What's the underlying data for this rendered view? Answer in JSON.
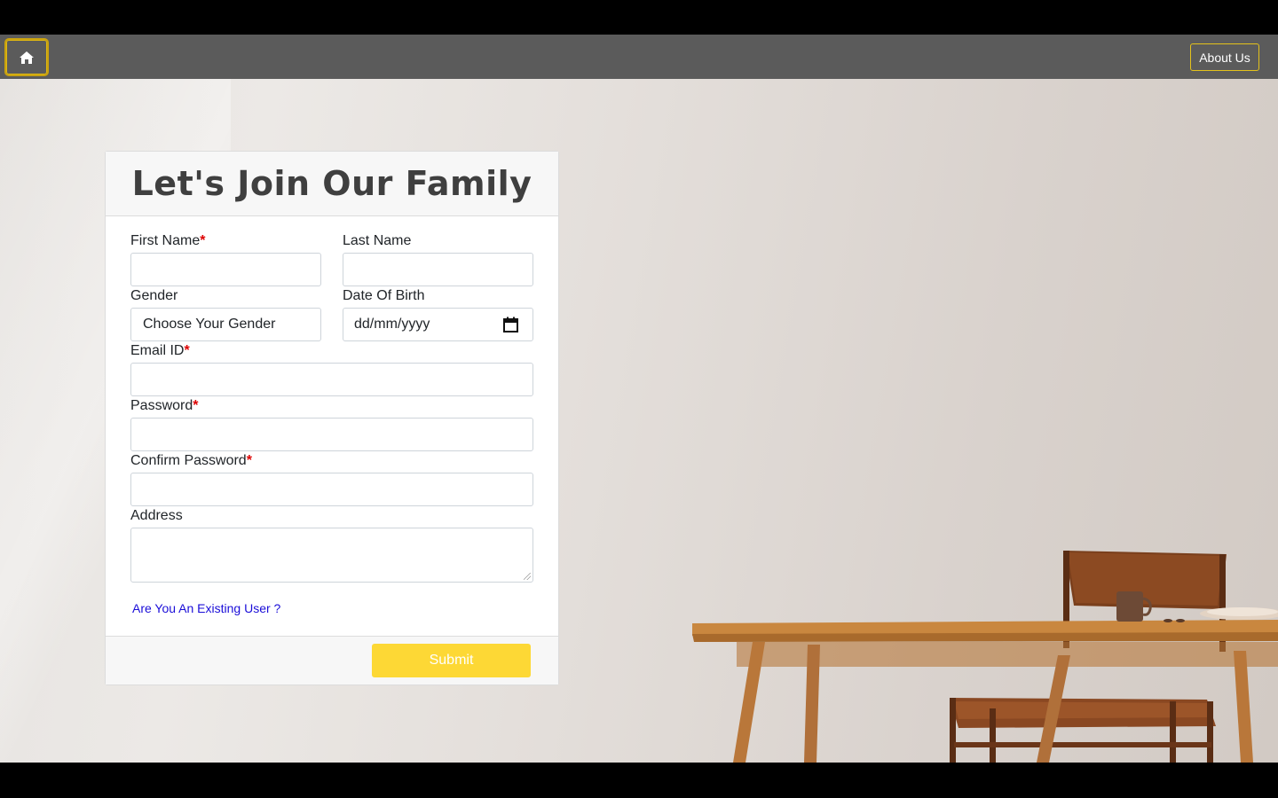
{
  "navbar": {
    "home_icon": "home-icon",
    "about_label": "About Us",
    "accent": "#e4c21b"
  },
  "form": {
    "title": "Let's Join Our Family",
    "required_mark": "*",
    "first_name": {
      "label": "First Name",
      "value": ""
    },
    "last_name": {
      "label": "Last Name",
      "value": ""
    },
    "gender": {
      "label": "Gender",
      "selected": "Choose Your Gender"
    },
    "dob": {
      "label": "Date Of Birth",
      "placeholder": "dd/mm/yyyy",
      "icon": "calendar-icon"
    },
    "email": {
      "label": "Email ID",
      "value": ""
    },
    "password": {
      "label": "Password",
      "value": ""
    },
    "confirm_password": {
      "label": "Confirm Password",
      "value": ""
    },
    "address": {
      "label": "Address",
      "value": ""
    },
    "existing_user_link": "Are You An Existing User ?",
    "submit_label": "Submit",
    "submit_color": "#fdd835"
  }
}
